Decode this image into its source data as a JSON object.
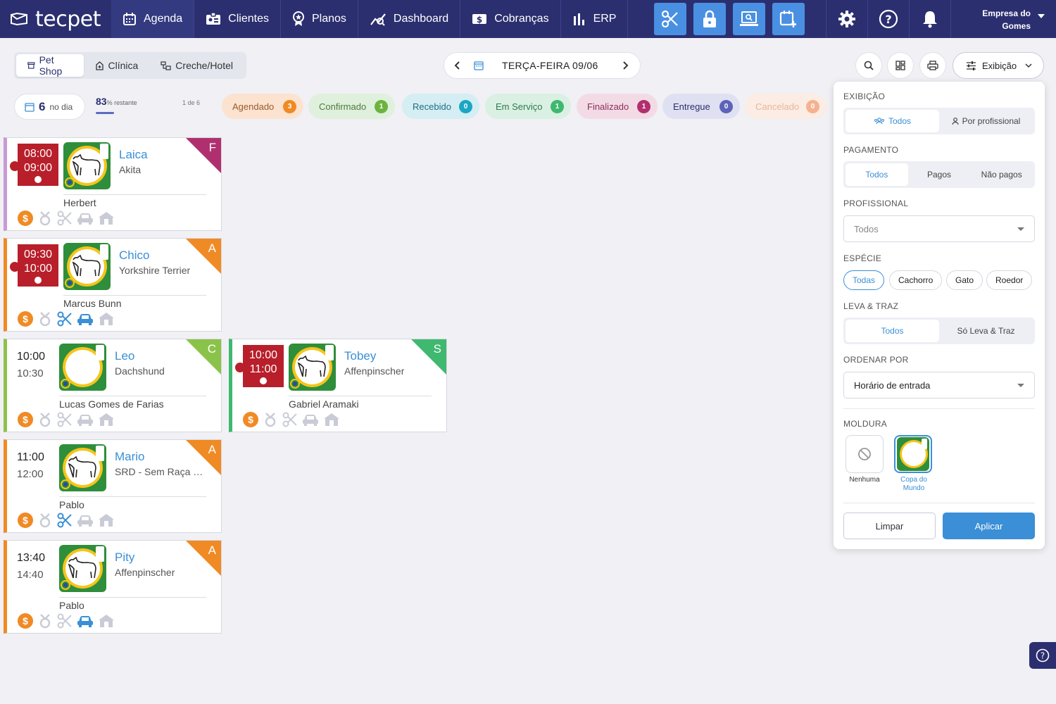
{
  "nav": {
    "logo": "tecpet",
    "items": [
      {
        "label": "Agenda",
        "icon": "calendar-icon"
      },
      {
        "label": "Clientes",
        "icon": "id-card-icon"
      },
      {
        "label": "Planos",
        "icon": "award-icon"
      },
      {
        "label": "Dashboard",
        "icon": "chart-line-icon"
      },
      {
        "label": "Cobranças",
        "icon": "dollar-bill-icon"
      },
      {
        "label": "ERP",
        "icon": "bar-chart-icon"
      }
    ],
    "quick_actions": [
      "scissors-icon",
      "lock-icon",
      "laptop-search-icon",
      "calendar-plus-icon"
    ],
    "utility_icons": [
      "gear-icon",
      "help-icon",
      "bell-icon"
    ],
    "company_line1": "Empresa do",
    "company_line2": "Gomes"
  },
  "toolbar": {
    "tabs": [
      "Pet Shop",
      "Clínica",
      "Creche/Hotel"
    ],
    "selected_tab": "Pet Shop",
    "date": "TERÇA-FEIRA 09/06",
    "exibicao_label": "Exibição"
  },
  "stats": {
    "day_count": "6",
    "day_label": "no dia",
    "remaining": "83",
    "remaining_suffix": "% restante",
    "page": "1 de 6"
  },
  "status_filters": [
    {
      "label": "Agendado",
      "count": "3",
      "bg": "#fbe3d0",
      "fg": "#9a5a2a",
      "badge": "#f08a24"
    },
    {
      "label": "Confirmado",
      "count": "1",
      "bg": "#dff0dc",
      "fg": "#4e7a3c",
      "badge": "#6cb33f"
    },
    {
      "label": "Recebido",
      "count": "0",
      "bg": "#d4eef3",
      "fg": "#1f6e83",
      "badge": "#1ba6c4"
    },
    {
      "label": "Em Serviço",
      "count": "1",
      "bg": "#d9f0e2",
      "fg": "#2f7a50",
      "badge": "#3fb870"
    },
    {
      "label": "Finalizado",
      "count": "1",
      "bg": "#f3dbe6",
      "fg": "#8a2f5c",
      "badge": "#b0306f"
    },
    {
      "label": "Entregue",
      "count": "0",
      "bg": "#dfe0f1",
      "fg": "#2b2f6f",
      "badge": "#5c63b8"
    },
    {
      "label": "Cancelado",
      "count": "0",
      "bg": "#fbece4",
      "fg": "#e7b79a",
      "badge": "#f5b190"
    }
  ],
  "appointments": [
    {
      "start": "08:00",
      "end": "09:00",
      "pet": "Laica",
      "breed": "Akita",
      "owner": "Herbert",
      "tag": "F",
      "tag_color": "#b0306f",
      "border": "#c79ad6",
      "red_time": true,
      "active_icons": [
        "coin"
      ]
    },
    {
      "start": "09:30",
      "end": "10:00",
      "pet": "Chico",
      "breed": "Yorkshire Terrier",
      "owner": "Marcus Bunn",
      "tag": "A",
      "tag_color": "#f08a24",
      "border": "#f08a24",
      "red_time": true,
      "active_icons": [
        "coin",
        "scissors",
        "car"
      ]
    },
    {
      "start": "10:00",
      "end": "10:30",
      "pet": "Leo",
      "breed": "Dachshund",
      "owner": "Lucas Gomes de Farias",
      "tag": "C",
      "tag_color": "#8bc34a",
      "border": "#8bc34a",
      "red_time": false,
      "active_icons": [
        "coin"
      ]
    },
    {
      "start": "10:00",
      "end": "11:00",
      "pet": "Tobey",
      "breed": "Affenpinscher",
      "owner": "Gabriel Aramaki",
      "tag": "S",
      "tag_color": "#3fb870",
      "border": "#3fb870",
      "red_time": true,
      "active_icons": [
        "coin"
      ]
    },
    {
      "start": "11:00",
      "end": "12:00",
      "pet": "Mario",
      "breed": "SRD - Sem Raça Defi...",
      "owner": "Pablo",
      "tag": "A",
      "tag_color": "#f08a24",
      "border": "#f08a24",
      "red_time": false,
      "active_icons": [
        "coin",
        "scissors"
      ]
    },
    {
      "start": "13:40",
      "end": "14:40",
      "pet": "Pity",
      "breed": "Affenpinscher",
      "owner": "Pablo",
      "tag": "A",
      "tag_color": "#f08a24",
      "border": "#f08a24",
      "red_time": false,
      "active_icons": [
        "coin",
        "car"
      ]
    }
  ],
  "panel": {
    "exibicao_title": "EXIBIÇÃO",
    "exibicao_options": [
      "Todos",
      "Por profissional"
    ],
    "pagamento_title": "PAGAMENTO",
    "pagamento_options": [
      "Todos",
      "Pagos",
      "Não pagos"
    ],
    "profissional_title": "PROFISSIONAL",
    "profissional_placeholder": "Todos",
    "especie_title": "ESPÉCIE",
    "especie_options": [
      "Todas",
      "Cachorro",
      "Gato",
      "Roedor"
    ],
    "leva_title": "LEVA & TRAZ",
    "leva_options": [
      "Todos",
      "Só Leva & Traz"
    ],
    "ordenar_title": "ORDENAR POR",
    "ordenar_value": "Horário de entrada",
    "moldura_title": "MOLDURA",
    "moldura_none": "Nenhuma",
    "moldura_copa": "Copa do Mundo",
    "clear": "Limpar",
    "apply": "Aplicar"
  }
}
